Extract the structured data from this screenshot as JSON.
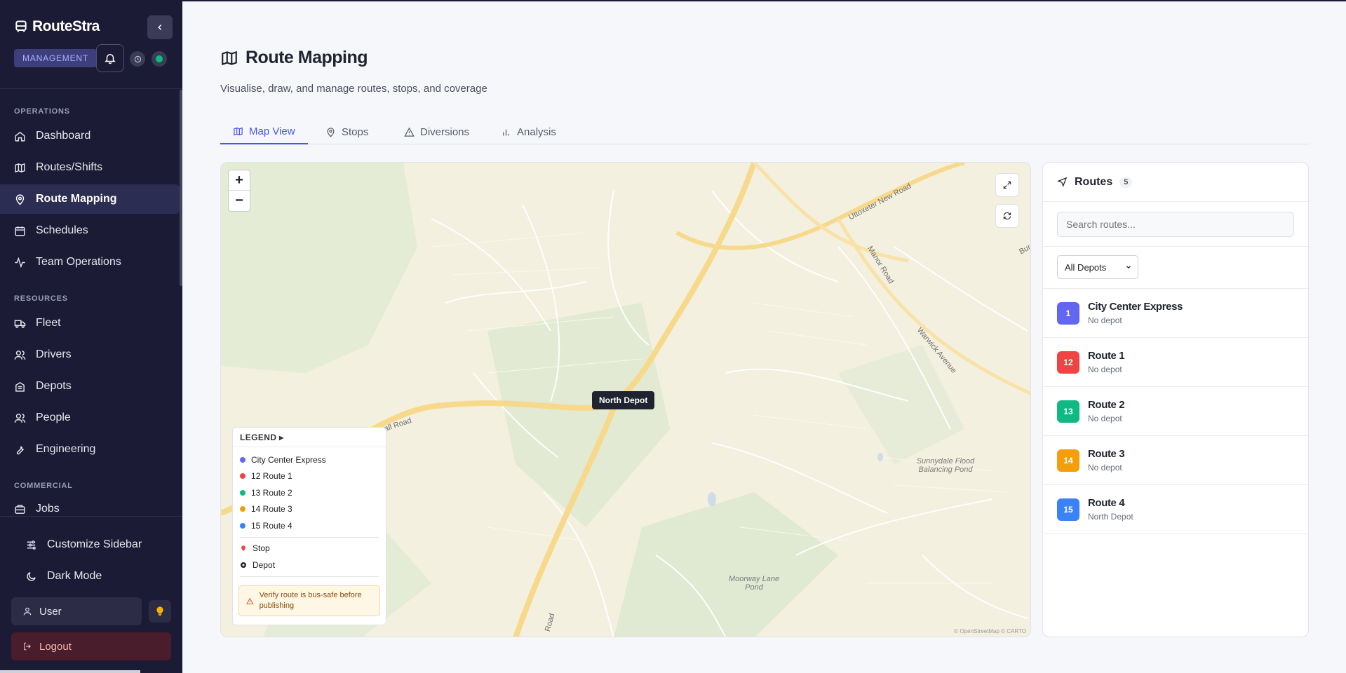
{
  "app": {
    "name": "RouteStra",
    "role_badge": "MANAGEMENT"
  },
  "sidebar": {
    "sections": [
      {
        "label": "OPERATIONS",
        "items": [
          {
            "label": "Dashboard",
            "icon": "home-icon"
          },
          {
            "label": "Routes/Shifts",
            "icon": "map-icon"
          },
          {
            "label": "Route Mapping",
            "icon": "map-pin-icon",
            "active": true
          },
          {
            "label": "Schedules",
            "icon": "calendar-icon"
          },
          {
            "label": "Team Operations",
            "icon": "activity-icon"
          }
        ]
      },
      {
        "label": "RESOURCES",
        "items": [
          {
            "label": "Fleet",
            "icon": "truck-icon"
          },
          {
            "label": "Drivers",
            "icon": "users-icon"
          },
          {
            "label": "Depots",
            "icon": "building-icon"
          },
          {
            "label": "People",
            "icon": "users-icon"
          },
          {
            "label": "Engineering",
            "icon": "wrench-icon"
          }
        ]
      },
      {
        "label": "COMMERCIAL",
        "items": [
          {
            "label": "Jobs",
            "icon": "briefcase-icon"
          }
        ]
      }
    ],
    "customize": "Customize Sidebar",
    "dark_mode": "Dark Mode",
    "user": "User",
    "logout": "Logout"
  },
  "page": {
    "title": "Route Mapping",
    "subtitle": "Visualise, draw, and manage routes, stops, and coverage",
    "tabs": [
      {
        "label": "Map View",
        "active": true
      },
      {
        "label": "Stops"
      },
      {
        "label": "Diversions"
      },
      {
        "label": "Analysis"
      }
    ]
  },
  "map": {
    "zoom_in": "+",
    "zoom_out": "−",
    "depot_tooltip": "North Depot",
    "labels": {
      "uttoxeter": "Uttoxeter New Road",
      "manor": "Manor Road",
      "warwick": "Warwick Avenue",
      "hall": "all Road",
      "bur": "Bur",
      "road_bottom": "Road",
      "sunnydale": "Sunnydale Flood Balancing Pond",
      "moorway": "Moorway Lane Pond"
    },
    "attribution": "© OpenStreetMap © CARTO",
    "legend": {
      "title": "LEGEND ▸",
      "routes": [
        {
          "label": "City Center Express",
          "color": "#6366f1"
        },
        {
          "label": "12 Route 1",
          "color": "#ef4444"
        },
        {
          "label": "13 Route 2",
          "color": "#10b981"
        },
        {
          "label": "14 Route 3",
          "color": "#f59e0b"
        },
        {
          "label": "15 Route 4",
          "color": "#3b82f6"
        }
      ],
      "stop": "Stop",
      "depot": "Depot",
      "warning": "Verify route is bus-safe before publishing"
    }
  },
  "routes_panel": {
    "title": "Routes",
    "count": "5",
    "search_placeholder": "Search routes...",
    "depot_filter": "All Depots",
    "routes": [
      {
        "badge": "1",
        "name": "City Center Express",
        "depot": "No depot",
        "color": "#6366f1"
      },
      {
        "badge": "12",
        "name": "Route 1",
        "depot": "No depot",
        "color": "#ef4444"
      },
      {
        "badge": "13",
        "name": "Route 2",
        "depot": "No depot",
        "color": "#10b981"
      },
      {
        "badge": "14",
        "name": "Route 3",
        "depot": "No depot",
        "color": "#f59e0b"
      },
      {
        "badge": "15",
        "name": "Route 4",
        "depot": "North Depot",
        "color": "#3b82f6"
      }
    ]
  }
}
